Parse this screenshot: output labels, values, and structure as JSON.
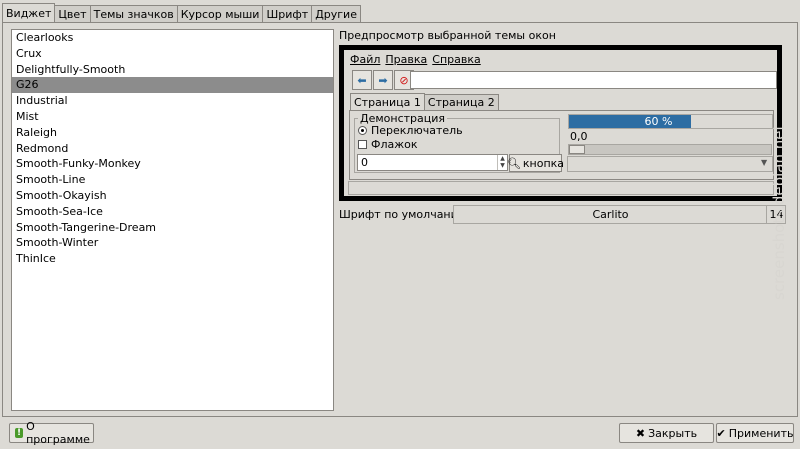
{
  "tabs": [
    "Виджет",
    "Цвет",
    "Темы значков",
    "Курсор мыши",
    "Шрифт",
    "Другие"
  ],
  "active_tab": "Виджет",
  "themes": [
    "Clearlooks",
    "Crux",
    "Delightfully-Smooth",
    "G26",
    "Industrial",
    "Mist",
    "Raleigh",
    "Redmond",
    "Smooth-Funky-Monkey",
    "Smooth-Line",
    "Smooth-Okayish",
    "Smooth-Sea-Ice",
    "Smooth-Tangerine-Dream",
    "Smooth-Winter",
    "ThinIce"
  ],
  "selected_theme": "G26",
  "preview": {
    "label": "Предпросмотр выбранной темы окон",
    "menu": [
      "Файл",
      "Правка",
      "Справка"
    ],
    "inner_tabs": [
      "Страница 1",
      "Страница 2"
    ],
    "demo_group": "Демонстрация",
    "radio_label": "Переключатель",
    "check_label": "Флажок",
    "spin_value": "0",
    "button_label": "кнопка",
    "progress": 0.6,
    "progress_text": "60 %",
    "value_label": "0,0"
  },
  "font": {
    "label": "Шрифт по умолчанию:",
    "name": "Carlito",
    "size": "14"
  },
  "buttons": {
    "about": "О программе",
    "close": "Закрыть",
    "apply": "Применить"
  },
  "watermark": "screenshots.debian.net",
  "colors": {
    "selection": "#8c8c8c",
    "progress": "#2d6da3",
    "background": "#dcdad5"
  }
}
